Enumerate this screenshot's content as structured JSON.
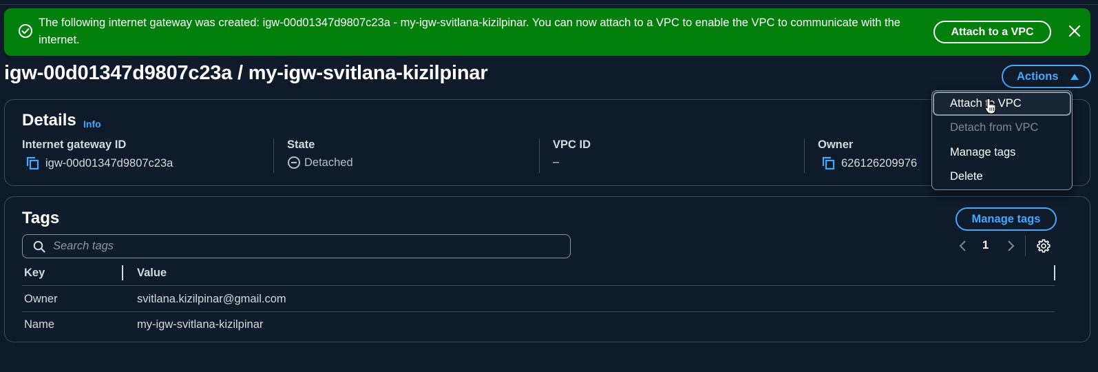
{
  "banner": {
    "message": "The following internet gateway was created: igw-00d01347d9807c23a - my-igw-svitlana-kizilpinar. You can now attach to a VPC to enable the VPC to communicate with the internet.",
    "attach_button": "Attach to a VPC",
    "color": "#037f0c"
  },
  "header": {
    "title": "igw-00d01347d9807c23a / my-igw-svitlana-kizilpinar",
    "actions_button": "Actions"
  },
  "details": {
    "title": "Details",
    "info": "Info",
    "fields": {
      "gateway_id": {
        "label": "Internet gateway ID",
        "value": "igw-00d01347d9807c23a"
      },
      "state": {
        "label": "State",
        "value": "Detached"
      },
      "vpc_id": {
        "label": "VPC ID",
        "value": "–"
      },
      "owner": {
        "label": "Owner",
        "value": "626126209976"
      }
    }
  },
  "tags": {
    "title": "Tags",
    "manage_button": "Manage tags",
    "search_placeholder": "Search tags",
    "page": "1",
    "columns": [
      "Key",
      "Value"
    ],
    "rows": [
      {
        "key": "Owner",
        "value": "svitlana.kizilpinar@gmail.com"
      },
      {
        "key": "Name",
        "value": "my-igw-svitlana-kizilpinar"
      }
    ]
  },
  "actions_menu": {
    "items": [
      {
        "label": "Attach to VPC",
        "enabled": true
      },
      {
        "label": "Detach from VPC",
        "enabled": false
      },
      {
        "label": "Manage tags",
        "enabled": true
      },
      {
        "label": "Delete",
        "enabled": true
      }
    ]
  },
  "colors": {
    "background": "#0f1b2a",
    "accent": "#42a9ff",
    "success": "#037f0c"
  },
  "icons": [
    "success-icon",
    "close-icon",
    "caret-up-icon",
    "copy-icon",
    "detached-status-icon",
    "search-icon",
    "chevron-left-icon",
    "chevron-right-icon",
    "gear-icon",
    "pointer-cursor-icon"
  ]
}
